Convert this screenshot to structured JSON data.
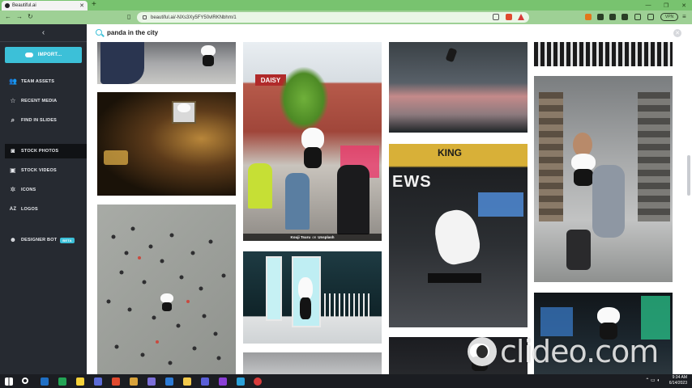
{
  "browser": {
    "tab_title": "Beautiful.ai",
    "url": "beautiful.ai/-NXs3Xy5FY50vlRKNbhm/1",
    "vpn_label": "VPN",
    "colors": {
      "tabbar": "#78c36f",
      "addressbar": "#9ed095"
    }
  },
  "sidebar": {
    "collapse_icon": "chevron-left-icon",
    "import_label": "IMPORT...",
    "items": [
      {
        "label": "TEAM ASSETS",
        "icon": "team-icon"
      },
      {
        "label": "RECENT MEDIA",
        "icon": "star-icon"
      },
      {
        "label": "FIND IN SLIDES",
        "icon": "search-icon"
      },
      {
        "label": "STOCK PHOTOS",
        "icon": "camera-icon",
        "active": true
      },
      {
        "label": "STOCK VIDEOS",
        "icon": "video-icon"
      },
      {
        "label": "ICONS",
        "icon": "gear-icon"
      },
      {
        "label": "LOGOS",
        "icon": "az-icon"
      },
      {
        "label": "DESIGNER BOT",
        "icon": "bot-icon",
        "badge": "BETA"
      }
    ],
    "colors": {
      "background": "#262a31",
      "accent": "#3cc0d8"
    }
  },
  "search": {
    "query": "panda in the city"
  },
  "photos": {
    "caption_author": "Kouji Tsuru",
    "caption_on": "on",
    "caption_source": "Unsplash"
  },
  "watermark": {
    "text": "clideo.com"
  },
  "taskbar": {
    "time": "9:34 AM",
    "date": "6/14/2023"
  }
}
